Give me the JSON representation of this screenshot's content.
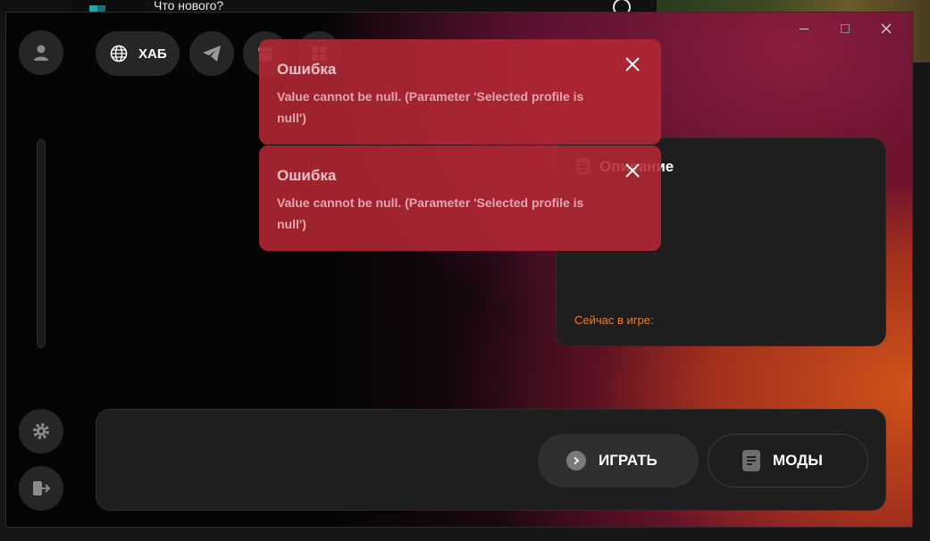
{
  "background": {
    "status_text": "Что нового?"
  },
  "window": {
    "controls": {
      "minimize": "minimize-icon",
      "maximize": "maximize-icon",
      "close": "close-icon"
    }
  },
  "top_nav": {
    "hub_label": "ХАБ",
    "icons": [
      "globe-icon",
      "telegram-icon",
      "store-icon",
      "apps-grid-icon"
    ]
  },
  "sidebar": {
    "top_icon": "user-icon",
    "bottom_icons": [
      "gear-icon",
      "logout-icon"
    ]
  },
  "description_panel": {
    "title": "Описание",
    "now_playing_label": "Сейчас в игре:"
  },
  "bottom_bar": {
    "play_label": "ИГРАТЬ",
    "mods_label": "МОДЫ"
  },
  "toasts": [
    {
      "title": "Ошибка",
      "message": "Value cannot be null. (Parameter 'Selected profile is null')"
    },
    {
      "title": "Ошибка",
      "message": "Value cannot be null. (Parameter 'Selected profile is null')"
    }
  ],
  "colors": {
    "accent_orange": "#f07a2a",
    "toast_red": "#b42834",
    "panel_bg": "#1e1e1e"
  }
}
